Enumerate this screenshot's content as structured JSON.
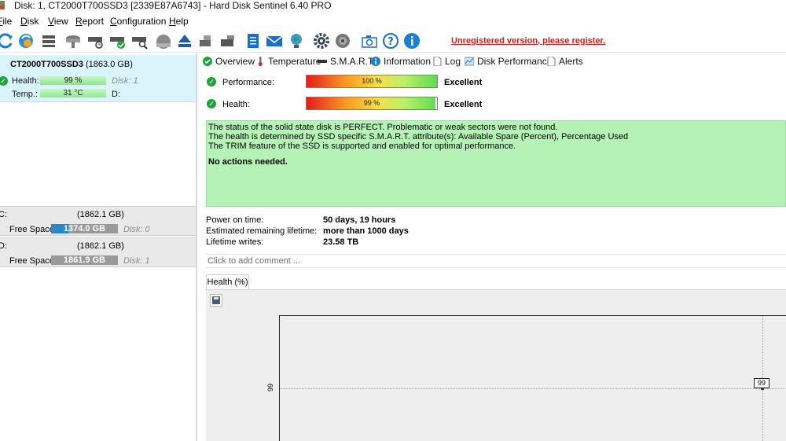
{
  "window": {
    "title": "Disk: 1, CT2000T700SSD3 [2339E87A6743]  -  Hard Disk Sentinel 6.40 PRO"
  },
  "menu": [
    {
      "label": "File"
    },
    {
      "label": "Disk"
    },
    {
      "label": "View"
    },
    {
      "label": "Report"
    },
    {
      "label": "Configuration"
    },
    {
      "label": "Help"
    }
  ],
  "toolbar": {
    "register_link": "Unregistered version, please register.",
    "icons": [
      "refresh-icon",
      "update-icon",
      "disk-list-icon",
      "disk-test-icon",
      "disk-info-icon",
      "disk-check-icon",
      "disk-search-icon",
      "health-icon",
      "eject-icon",
      "usb-icon",
      "drive-icon",
      "report-icon",
      "email-icon",
      "network-icon",
      "settings-icon",
      "sound-icon",
      "screenshot-icon",
      "help-icon",
      "info-icon"
    ]
  },
  "disk": {
    "model": "CT2000T700SSD3",
    "capacity": "(1863.0 GB)",
    "health_label": "Health:",
    "health_value": "99 %",
    "health_disk": "Disk: 1",
    "temp_label": "Temp.:",
    "temp_value": "31 °C",
    "temp_drive": "D:",
    "health_fraction": 0.99
  },
  "volumes": [
    {
      "letter": "C:",
      "size": "(1862.1 GB)",
      "free_label": "Free Space",
      "free_value": "1374.0 GB",
      "disk": "Disk: 0",
      "used_fraction": 0.26,
      "bar_color": "#2b87c7"
    },
    {
      "letter": "D:",
      "size": "(1862.1 GB)",
      "free_label": "Free Space",
      "free_value": "1861.9 GB",
      "disk": "Disk: 1",
      "used_fraction": 0.0,
      "bar_color": "#9a9a9a"
    }
  ],
  "tabs": [
    {
      "label": "Overview",
      "icon": "check-icon"
    },
    {
      "label": "Temperature",
      "icon": "thermometer-icon"
    },
    {
      "label": "S.M.A.R.T.",
      "icon": "smart-icon"
    },
    {
      "label": "Information",
      "icon": "info-icon"
    },
    {
      "label": "Log",
      "icon": "log-icon"
    },
    {
      "label": "Disk Performance",
      "icon": "performance-icon"
    },
    {
      "label": "Alerts",
      "icon": "alerts-icon"
    }
  ],
  "overview": {
    "performance": {
      "label": "Performance:",
      "gauge": "100 %",
      "value": "Excellent",
      "fraction": 1.0
    },
    "health": {
      "label": "Health:",
      "gauge": "99 %",
      "value": "Excellent",
      "fraction": 0.99
    },
    "status_lines": [
      "The status of the solid state disk is PERFECT. Problematic or weak sectors were not found.",
      "The health is determined by SSD specific S.M.A.R.T. attribute(s):  Available Spare (Percent), Percentage Used",
      "The TRIM feature of the SSD is supported and enabled for optimal performance."
    ],
    "status_action": "No actions needed.",
    "info": [
      {
        "label": "Power on time:",
        "value": "50 days, 19 hours"
      },
      {
        "label": "Estimated remaining lifetime:",
        "value": "more than 1000 days"
      },
      {
        "label": "Lifetime writes:",
        "value": "23.58 TB"
      }
    ],
    "comment_placeholder": "Click to add comment ..."
  },
  "chart_tab": "Health (%)",
  "chart_data": {
    "type": "line",
    "title": "",
    "xlabel": "",
    "ylabel": "",
    "y_tick_labels": [
      "99"
    ],
    "series": [
      {
        "values": [
          99
        ]
      }
    ],
    "point_labels": [
      "99"
    ]
  }
}
